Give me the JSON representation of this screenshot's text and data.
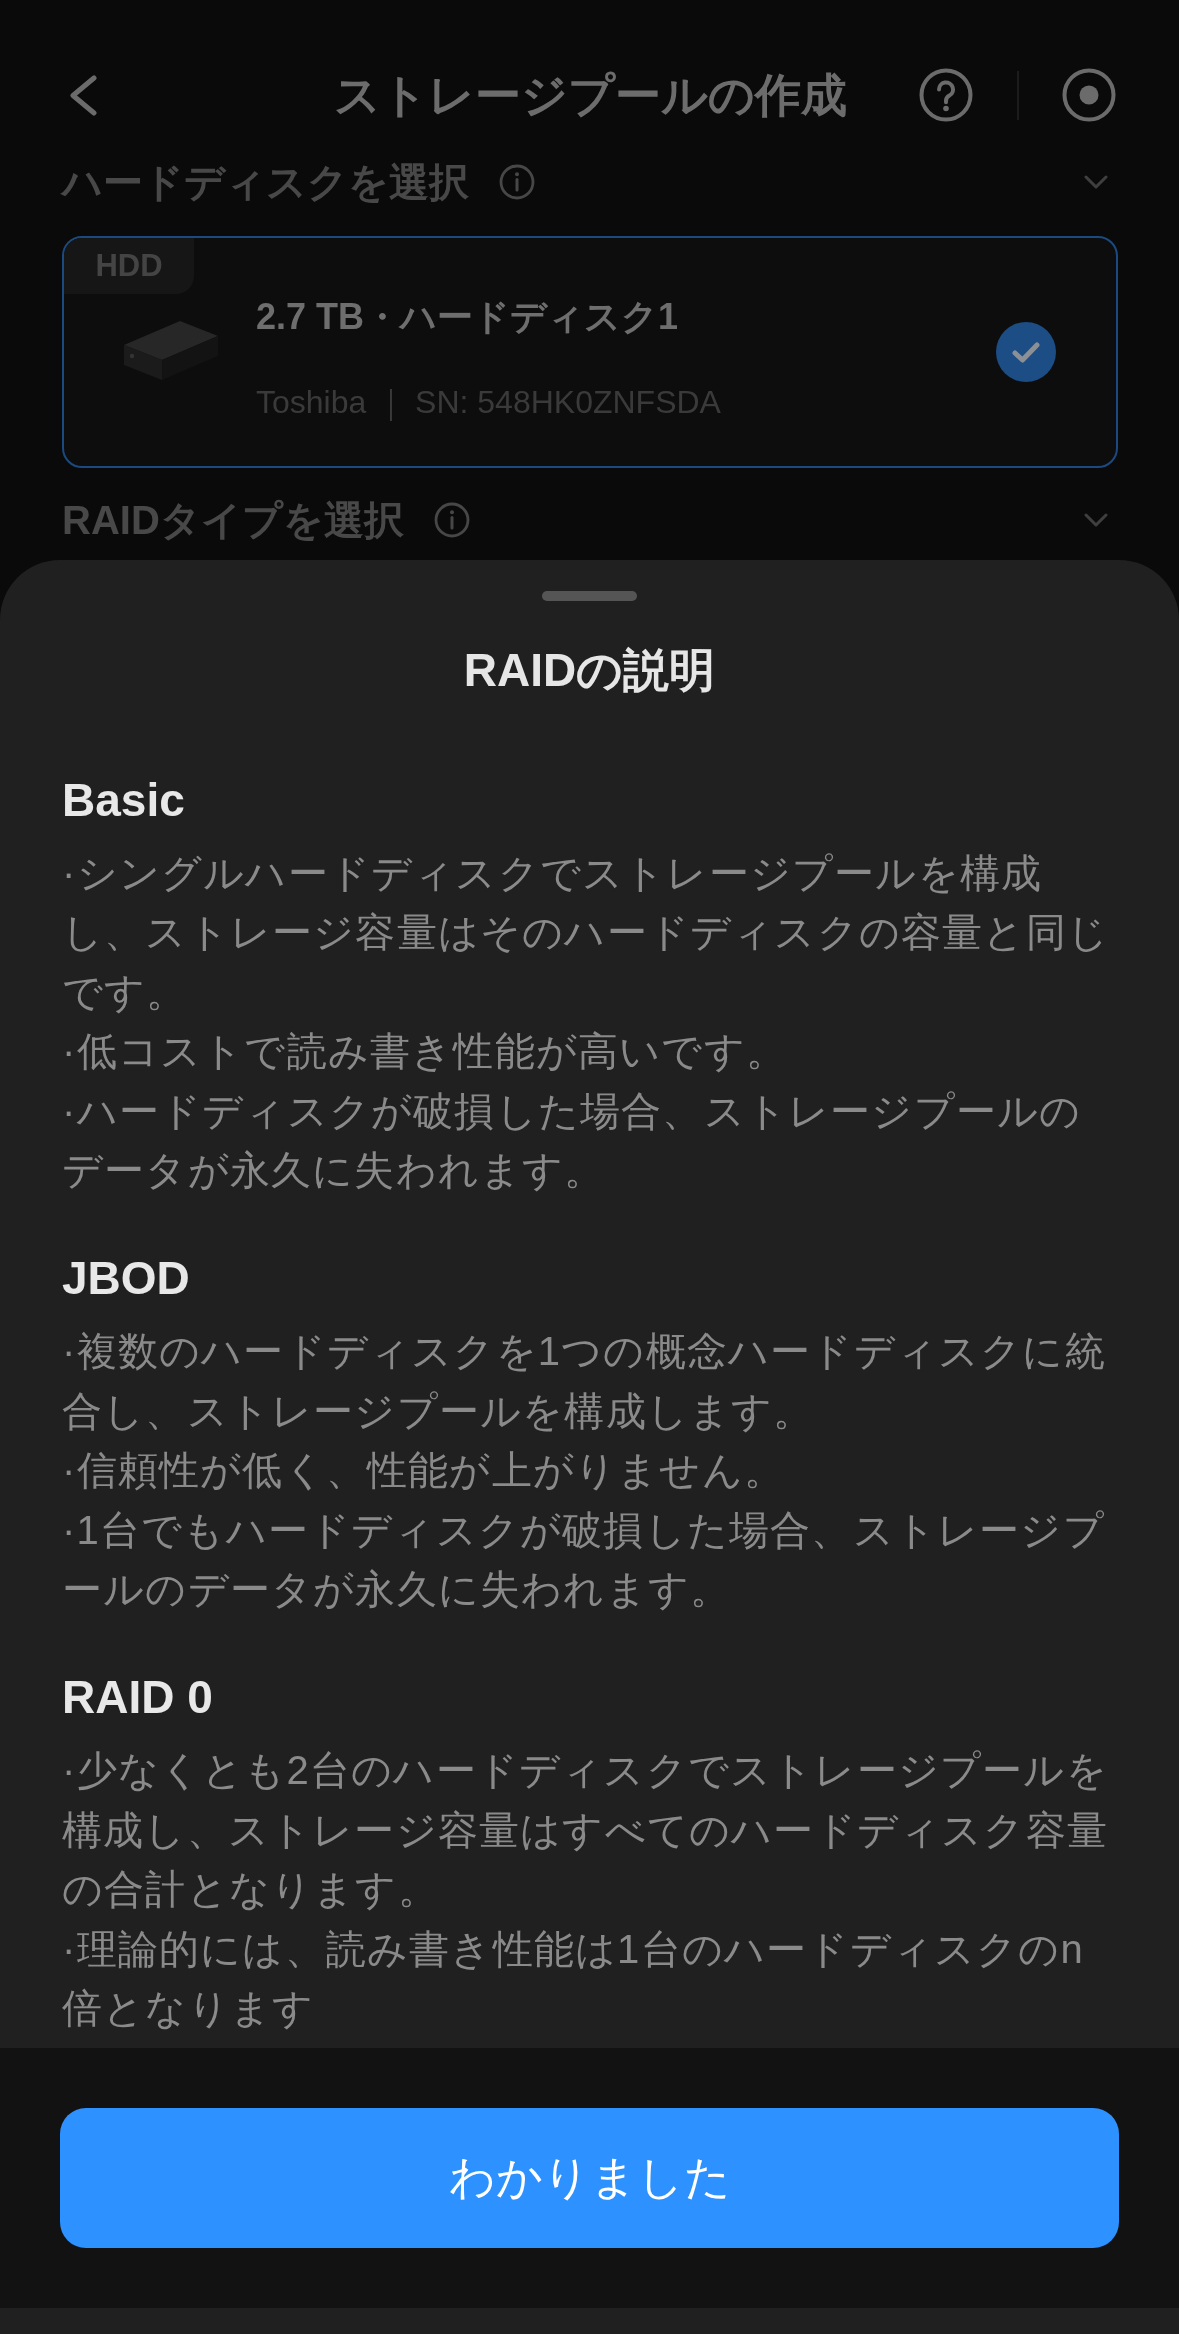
{
  "header": {
    "title": "ストレージプールの作成"
  },
  "disk_section": {
    "title": "ハードディスクを選択",
    "disks": [
      {
        "tag": "HDD",
        "title": "2.7 TB・ハードディスク1",
        "details": "Toshiba ｜ SN: 548HK0ZNFSDA",
        "selected": true
      }
    ]
  },
  "raid_section": {
    "title": "RAIDタイプを選択"
  },
  "sheet": {
    "title": "RAIDの説明",
    "raid_types": [
      {
        "name": "Basic",
        "points": [
          "·シングルハードディスクでストレージプールを構成し、ストレージ容量はそのハードディスクの容量と同じです。",
          "·低コストで読み書き性能が高いです。",
          "·ハードディスクが破損した場合、ストレージプールのデータが永久に失われます。"
        ]
      },
      {
        "name": "JBOD",
        "points": [
          "·複数のハードディスクを1つの概念ハードディスクに統合し、ストレージプールを構成します。",
          "·信頼性が低く、性能が上がりません。",
          "·1台でもハードディスクが破損した場合、ストレージプールのデータが永久に失われます。"
        ]
      },
      {
        "name": "RAID 0",
        "points": [
          "·少なくとも2台のハードディスクでストレージプールを構成し、ストレージ容量はすべてのハードディスク容量の合計となります。",
          "·理論的には、読み書き性能は1台のハードディスクのn倍となります"
        ]
      }
    ],
    "confirm_button": "わかりました"
  }
}
